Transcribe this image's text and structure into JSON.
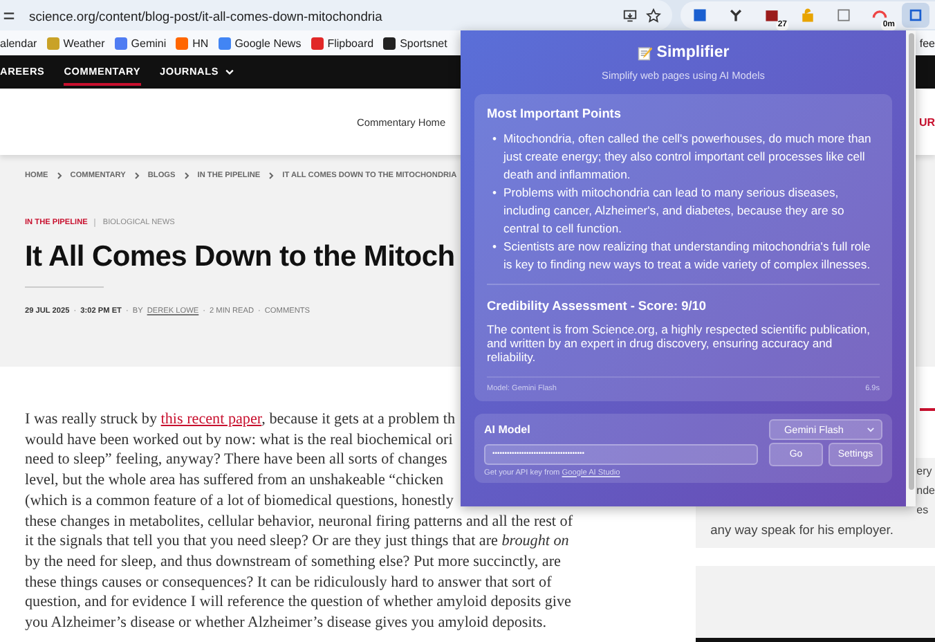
{
  "browser": {
    "url": "science.org/content/blog-post/it-all-comes-down-mitochondria",
    "extensions": [
      {
        "selected": false
      },
      {
        "selected": false
      },
      {
        "badge": "27",
        "selected": false
      },
      {
        "selected": false
      },
      {
        "selected": false
      },
      {
        "badge": "0m",
        "selected": false
      },
      {
        "selected": true
      }
    ]
  },
  "bookmarks": [
    {
      "label": "alendar",
      "kind": "plain"
    },
    {
      "label": "Weather",
      "kind": "icon"
    },
    {
      "label": "Gemini",
      "kind": "icon"
    },
    {
      "label": "HN",
      "kind": "icon"
    },
    {
      "label": "Google News",
      "kind": "icon"
    },
    {
      "label": "Flipboard",
      "kind": "icon"
    },
    {
      "label": "Sportsnet",
      "kind": "icon"
    },
    {
      "label": "fee",
      "kind": "plain"
    }
  ],
  "nav": [
    {
      "label": "AREERS",
      "selected": false,
      "dropdown": false
    },
    {
      "label": "COMMENTARY",
      "selected": true,
      "dropdown": false
    },
    {
      "label": "JOURNALS",
      "selected": false,
      "dropdown": true
    }
  ],
  "subnav": {
    "link": "Commentary Home",
    "edge_text": "UR"
  },
  "breadcrumbs": [
    "HOME",
    "COMMENTARY",
    "BLOGS",
    "IN THE PIPELINE",
    "IT ALL COMES DOWN TO THE MITOCHONDRIA"
  ],
  "article": {
    "category": "IN THE PIPELINE",
    "tag": "BIOLOGICAL NEWS",
    "title": "It All Comes Down to the Mitoch",
    "separator": "·",
    "date": "29 JUL 2025",
    "time": "3:02 PM ET",
    "byline": "BY",
    "author": "DEREK LOWE",
    "read_time": "2 MIN READ",
    "comments": "COMMENTS",
    "partial_lines": [
      {
        "before": "I was really struck by ",
        "link": "this recent paper",
        "after": ", because it gets at a problem th"
      },
      {
        "before": "would have been worked out by now: what is the real biochemical ori"
      },
      {
        "before": "need to sleep” feeling, anyway? There have been all sorts of changes"
      },
      {
        "before": "level, but the whole area has suffered from an unshakeable “chicken"
      },
      {
        "before": "(which is a common feature of a lot of biomedical questions, honestly"
      }
    ],
    "lines": [
      "these changes in metabolites, cellular behavior, neuronal firing patterns and all the rest of",
      "it the signals that tell you that you need sleep? Or are they just things that are *brought on*",
      "by the need for sleep, and thus downstream of something else? Put more succinctly, are",
      "these things causes or consequences? It can be ridiculously hard to answer that sort of",
      "question, and for evidence I will reference the question of whether amyloid deposits give",
      "you Alzheimer’s disease or whether Alzheimer’s disease gives you amyloid deposits."
    ]
  },
  "sidebar": {
    "fragments": [
      "ery",
      "nde",
      "es"
    ],
    "last_line": "any way speak for his employer."
  },
  "popup": {
    "title": "Simplifier",
    "subtitle": "Simplify web pages using AI Models",
    "points_heading": "Most Important Points",
    "bullet": "•",
    "points": [
      "Mitochondria, often called the cell's powerhouses, do much more than just create energy; they also control important cell processes like cell death and inflammation.",
      "Problems with mitochondria can lead to many serious diseases, including cancer, Alzheimer's, and diabetes, because they are so central to cell function.",
      "Scientists are now realizing that understanding mitochondria's full role is key to finding new ways to treat a wide variety of complex illnesses."
    ],
    "credibility_heading": "Credibility Assessment - Score: 9/10",
    "credibility_text": "The content is from Science.org, a highly respected scientific publication, and written by an expert in drug discovery, ensuring accuracy and reliability.",
    "model_note": "Model: Gemini Flash",
    "elapsed": "6.9s",
    "model_label": "AI Model",
    "model_select": "Gemini Flash",
    "api_key": "••••••••••••••••••••••••••••••••••••••",
    "go": "Go",
    "settings": "Settings",
    "hint": "Get your API key from ",
    "hint_link": "Google AI Studio"
  }
}
